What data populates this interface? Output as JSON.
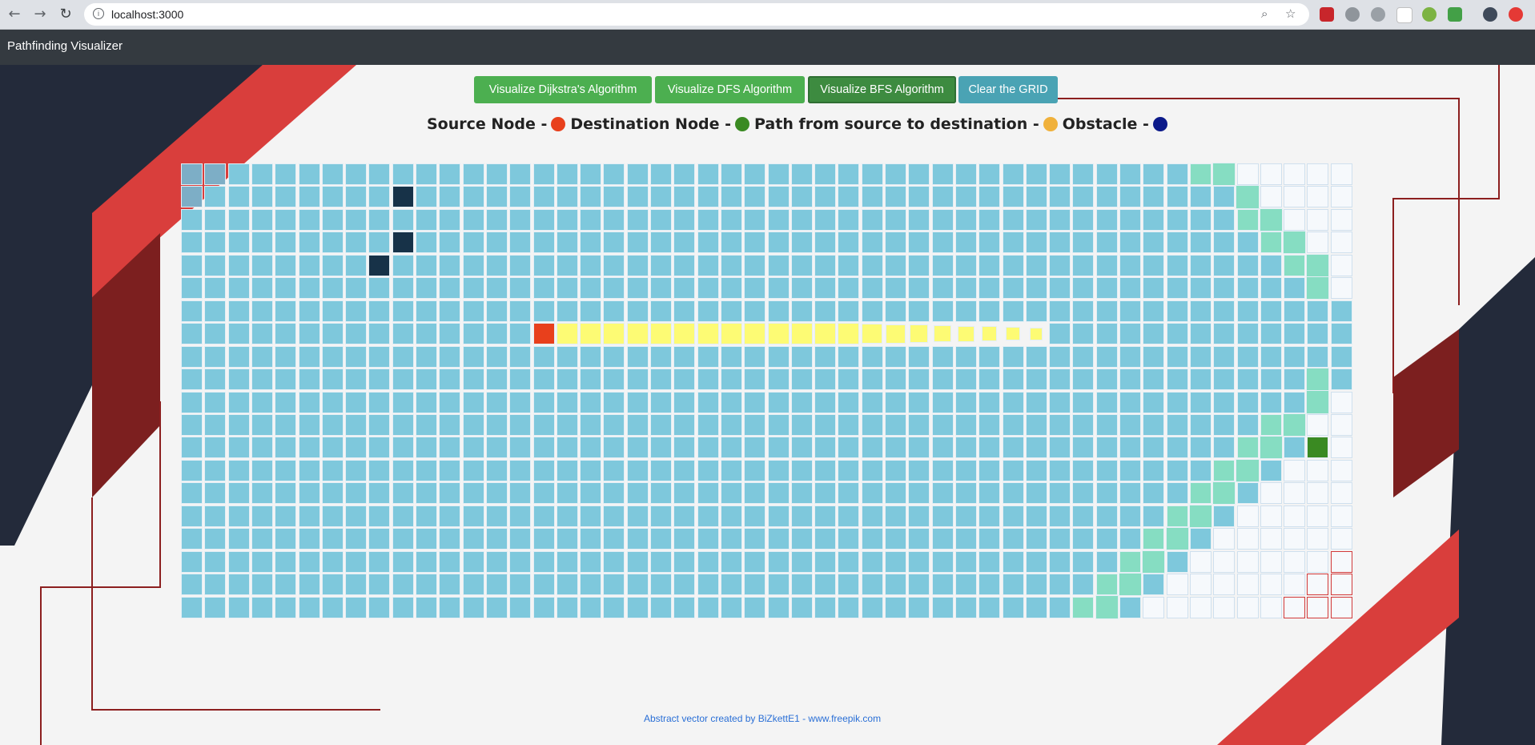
{
  "browser": {
    "url": "localhost:3000",
    "info_glyph": "i",
    "back_glyph": "←",
    "forward_glyph": "→",
    "reload_glyph": "↻",
    "zoom_glyph": "⌕",
    "star_glyph": "☆"
  },
  "app": {
    "title": "Pathfinding Visualizer"
  },
  "toolbar": {
    "dijkstra_label": "Visualize Dijkstra's Algorithm",
    "dfs_label": "Visualize DFS Algorithm",
    "bfs_label": "Visualize BFS Algorithm",
    "clear_label": "Clear the GRID"
  },
  "legend": {
    "source_label": "Source Node -",
    "destination_label": "Destination Node -",
    "path_label": "Path from source to destination -",
    "obstacle_label": "Obstacle -",
    "source_color": "#e8401c",
    "destination_color": "#3a8a22",
    "path_color": "#f0b13b",
    "obstacle_color": "#0c1a8a"
  },
  "grid": {
    "rows": 20,
    "cols": 50,
    "colors": {
      "visited": "#7ec8dc",
      "unvisited": "#f6f9fc",
      "frontier": "#86ddc2",
      "obstacle": "#173248",
      "source": "#e8401c",
      "destination": "#3a8a22",
      "path": "#fdfb74",
      "early_visited": "#7daec6",
      "unvisited_red": "#d23a3a"
    },
    "source": [
      7,
      15
    ],
    "destination": [
      12,
      48
    ],
    "obstacles": [
      [
        1,
        9
      ],
      [
        3,
        9
      ],
      [
        4,
        8
      ]
    ],
    "path_cells": [
      [
        7,
        16
      ],
      [
        7,
        17
      ],
      [
        7,
        18
      ],
      [
        7,
        19
      ],
      [
        7,
        20
      ],
      [
        7,
        21
      ],
      [
        7,
        22
      ],
      [
        7,
        23
      ],
      [
        7,
        24
      ],
      [
        7,
        25
      ],
      [
        7,
        26
      ],
      [
        7,
        27
      ],
      [
        7,
        28
      ],
      [
        7,
        29
      ],
      [
        7,
        30
      ],
      [
        7,
        31
      ],
      [
        7,
        32
      ],
      [
        7,
        33
      ],
      [
        7,
        34
      ],
      [
        7,
        35
      ],
      [
        7,
        36
      ]
    ],
    "early_visited": [
      [
        0,
        0
      ],
      [
        0,
        1
      ],
      [
        1,
        0
      ]
    ],
    "frontier_front": [
      [
        0,
        44
      ],
      [
        1,
        45
      ],
      [
        2,
        46
      ],
      [
        3,
        47
      ],
      [
        4,
        48
      ],
      [
        5,
        48
      ],
      [
        9,
        48
      ],
      [
        10,
        48
      ],
      [
        11,
        47
      ],
      [
        12,
        46
      ],
      [
        13,
        45
      ],
      [
        14,
        44
      ],
      [
        15,
        43
      ],
      [
        16,
        42
      ],
      [
        17,
        41
      ],
      [
        18,
        40
      ],
      [
        19,
        39
      ]
    ],
    "frontier_back": [
      [
        0,
        43
      ],
      [
        2,
        45
      ],
      [
        3,
        46
      ],
      [
        4,
        47
      ],
      [
        11,
        46
      ],
      [
        12,
        45
      ],
      [
        13,
        44
      ],
      [
        14,
        43
      ],
      [
        15,
        42
      ],
      [
        16,
        41
      ],
      [
        17,
        40
      ],
      [
        18,
        39
      ],
      [
        19,
        38
      ]
    ],
    "unvisited_from_col": [
      45,
      46,
      47,
      48,
      49,
      49,
      50,
      50,
      50,
      50,
      49,
      48,
      48,
      47,
      46,
      45,
      44,
      43,
      42,
      41
    ],
    "red_unvisited": [
      [
        17,
        49
      ],
      [
        18,
        48
      ],
      [
        18,
        49
      ],
      [
        19,
        47
      ],
      [
        19,
        48
      ],
      [
        19,
        49
      ]
    ]
  },
  "footer": {
    "credit": "Abstract vector created by BiZkettE1 - www.freepik.com"
  }
}
